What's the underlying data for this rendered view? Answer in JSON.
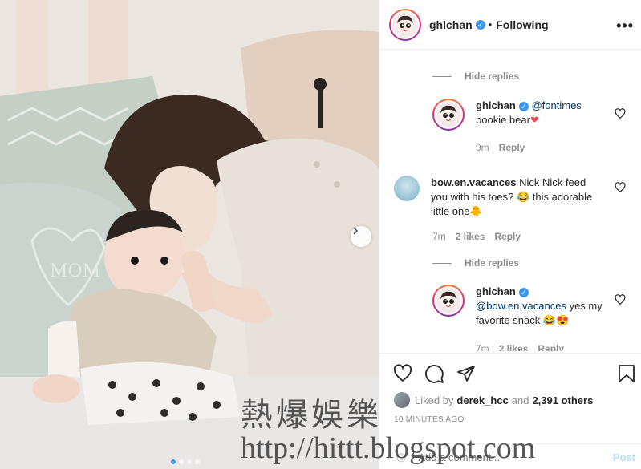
{
  "post": {
    "carousel_dots": 4,
    "active_dot": 0
  },
  "header": {
    "username": "ghlchan",
    "bullet": "•",
    "follow_status": "Following",
    "more_icon": "more-horizontal-icon"
  },
  "comments": {
    "hide_replies_1": "Hide replies",
    "reply1": {
      "username": "ghlchan",
      "mention": "@fontimes",
      "text": "pookie bear",
      "emoji": "❤",
      "age": "9m",
      "reply_label": "Reply"
    },
    "comment2": {
      "username": "bow.en.vacances",
      "text": "Nick Nick feed you with his toes? 😂 this adorable little one🐥",
      "age": "7m",
      "likes": "2 likes",
      "reply_label": "Reply"
    },
    "hide_replies_2": "Hide replies",
    "reply2": {
      "username": "ghlchan",
      "mention": "@bow.en.vacances",
      "text": "yes my favorite snack 😂😍",
      "age": "7m",
      "likes": "2 likes",
      "reply_label": "Reply"
    }
  },
  "actions": {
    "liked_by_label": "Liked by",
    "liked_by_user": "derek_hcc",
    "and_label": "and",
    "others": "2,391 others",
    "timestamp": "10 MINUTES AGO",
    "comment_placeholder": "Add a comment...",
    "post_label": "Post"
  },
  "watermark": {
    "line1": "熱爆娛樂",
    "line2": "http://hittt.blogspot.com"
  },
  "colors": {
    "link_blue": "#00376b",
    "verified_blue": "#3897f0",
    "heart_red": "#ed4956",
    "post_disabled": "#b2dffc"
  }
}
